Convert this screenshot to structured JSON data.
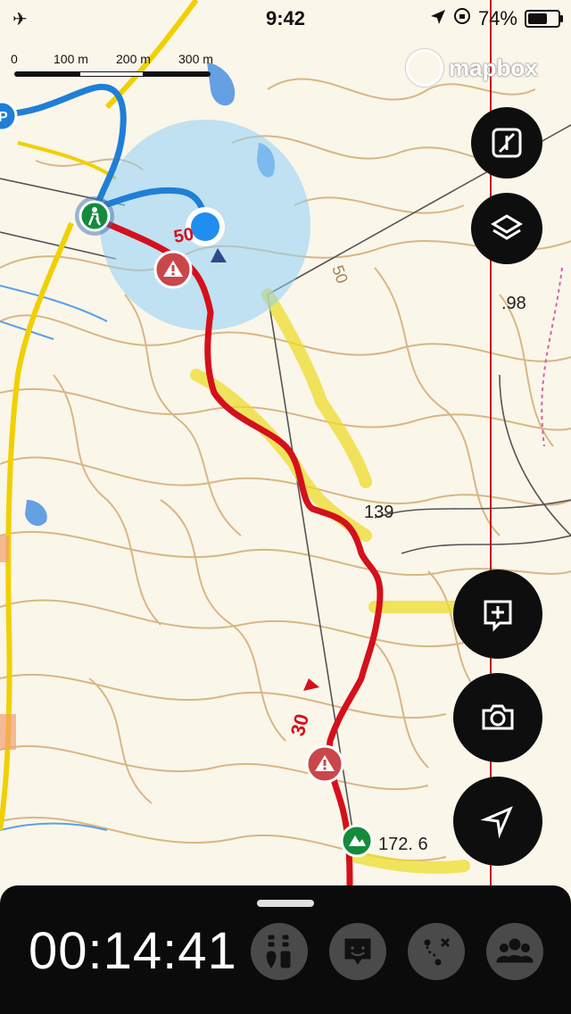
{
  "status_bar": {
    "time": "9:42",
    "battery_percent": "74%",
    "battery_level": 0.74,
    "left_icon": "airplane-icon",
    "right_icons": [
      "location-arrow-icon",
      "rotation-lock-icon",
      "battery-icon"
    ]
  },
  "map": {
    "scale_labels": [
      "0",
      "100 m",
      "200 m",
      "300 m"
    ],
    "attribution": "mapbox",
    "elevation_labels": {
      "peak_139": "139",
      "peak_172": "172. 6",
      "contour_50": "50",
      "contour_30": "30",
      "spot_98": ".98",
      "partial_top": "50"
    },
    "icons": [
      "hiker-start-icon",
      "warning-icon",
      "warning-icon",
      "summit-icon",
      "parking-icon",
      "current-location-dot"
    ],
    "colors": {
      "planned_route": "#d4101c",
      "traveled_track": "#1f7fd6",
      "road": "#f0d000",
      "contour": "#c9a46a",
      "accuracy_circle": "#8fcff5"
    }
  },
  "controls": {
    "right_buttons": [
      "collapse-icon",
      "layers-icon",
      "add-note-icon",
      "camera-icon",
      "navigation-arrow-icon"
    ]
  },
  "bottom_panel": {
    "elapsed_time": "00:14:41",
    "tools": [
      "route-info-icon",
      "memo-icon",
      "route-edit-icon",
      "group-icon"
    ]
  }
}
